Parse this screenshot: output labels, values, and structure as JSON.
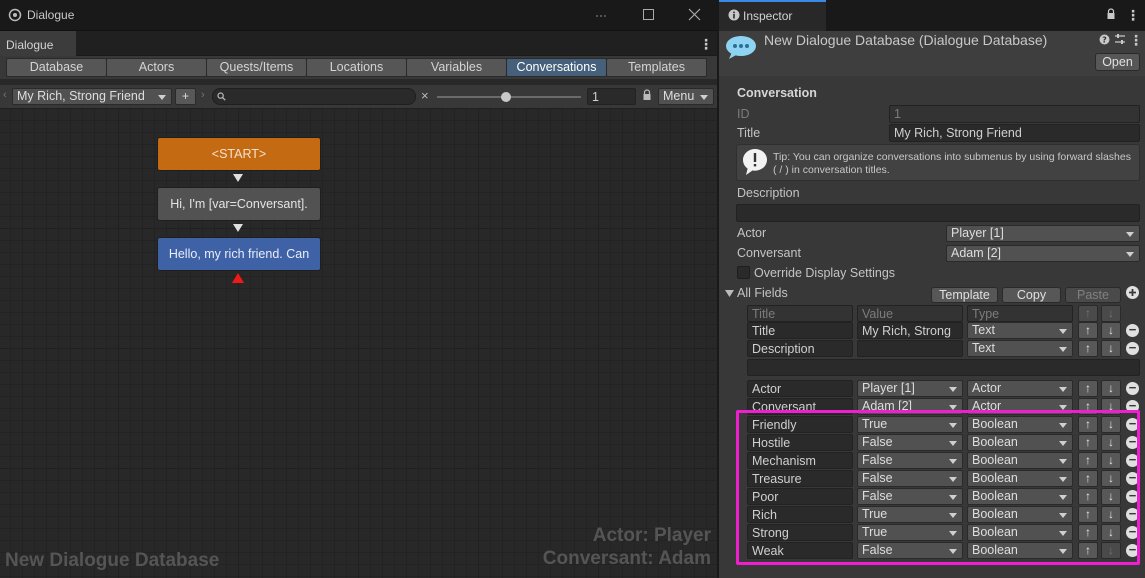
{
  "left_window": {
    "title": "Dialogue",
    "tab": "Dialogue",
    "min_icon": "minimize-icon",
    "max_icon": "maximize-icon",
    "close_icon": "close-icon",
    "main_tabs": [
      {
        "label": "Database"
      },
      {
        "label": "Actors"
      },
      {
        "label": "Quests/Items"
      },
      {
        "label": "Locations"
      },
      {
        "label": "Variables"
      },
      {
        "label": "Conversations"
      },
      {
        "label": "Templates"
      }
    ],
    "active_tab": "Conversations",
    "conversation_select": "My Rich, Strong Friend",
    "plus_label": "+",
    "clear_label": "×",
    "zoom_value": "1",
    "menu_label": "Menu",
    "nodes": {
      "start": "<START>",
      "npc": "Hi, I'm [var=Conversant].",
      "pc": "Hello, my rich friend. Can"
    },
    "watermark_db": "New Dialogue Database",
    "watermark_actor": "Actor: Player",
    "watermark_conversant": "Conversant: Adam",
    "colors": {
      "start_node": "#c46a12",
      "npc_node": "#525252",
      "pc_node": "#3f61a5",
      "active_tab": "#46607c"
    }
  },
  "inspector": {
    "tab": "Inspector",
    "asset_title": "New Dialogue Database (Dialogue Database)",
    "open_label": "Open",
    "section": "Conversation",
    "id_label": "ID",
    "id_value": "1",
    "title_label": "Title",
    "title_value": "My Rich, Strong Friend",
    "tip": "Tip: You can organize conversations into submenus by using forward slashes ( / ) in conversation titles.",
    "description_label": "Description",
    "actor_label": "Actor",
    "actor_value": "Player [1]",
    "conversant_label": "Conversant",
    "conversant_value": "Adam [2]",
    "override_label": "Override Display Settings",
    "all_fields_label": "All Fields",
    "template_label": "Template",
    "copy_label": "Copy",
    "paste_label": "Paste",
    "col_title": "Title",
    "col_value": "Value",
    "col_type": "Type",
    "up_arrow": "↑",
    "down_arrow": "↓",
    "minus": "−",
    "highlight_color": "#ef1fcf",
    "rows": [
      {
        "title": "Title",
        "value": "My Rich, Strong",
        "type": "Text",
        "value_dd": false
      },
      {
        "title": "Description",
        "value": "",
        "type": "Text",
        "value_dd": false
      },
      {
        "title": "Actor",
        "value": "Player [1]",
        "type": "Actor",
        "value_dd": true
      },
      {
        "title": "Conversant",
        "value": "Adam [2]",
        "type": "Actor",
        "value_dd": true
      },
      {
        "title": "Friendly",
        "value": "True",
        "type": "Boolean",
        "value_dd": true
      },
      {
        "title": "Hostile",
        "value": "False",
        "type": "Boolean",
        "value_dd": true
      },
      {
        "title": "Mechanism",
        "value": "False",
        "type": "Boolean",
        "value_dd": true
      },
      {
        "title": "Treasure",
        "value": "False",
        "type": "Boolean",
        "value_dd": true
      },
      {
        "title": "Poor",
        "value": "False",
        "type": "Boolean",
        "value_dd": true
      },
      {
        "title": "Rich",
        "value": "True",
        "type": "Boolean",
        "value_dd": true
      },
      {
        "title": "Strong",
        "value": "True",
        "type": "Boolean",
        "value_dd": true
      },
      {
        "title": "Weak",
        "value": "False",
        "type": "Boolean",
        "value_dd": true
      }
    ]
  }
}
